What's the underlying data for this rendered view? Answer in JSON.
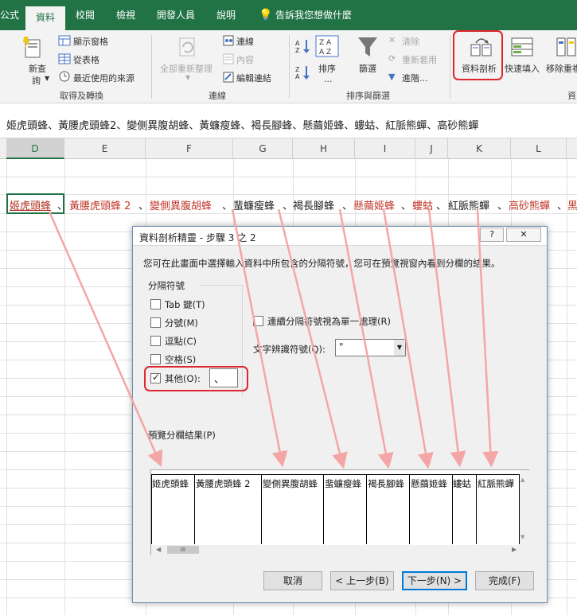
{
  "tabs": [
    {
      "label": "公式"
    },
    {
      "label": "資料",
      "active": true
    },
    {
      "label": "校閱"
    },
    {
      "label": "檢視"
    },
    {
      "label": "開發人員"
    },
    {
      "label": "說明"
    }
  ],
  "tell_me": "告訴我您想做什麼",
  "ribbon": {
    "new_query": [
      "新查",
      "詢"
    ],
    "show_queries": "顯示窗格",
    "from_table": "從表格",
    "recent_sources": "最近使用的來源",
    "get_transform_group": "取得及轉換",
    "refresh_all": "全部重新整理",
    "connections": "連線",
    "properties": "內容",
    "edit_links": "編輯連結",
    "connections_group": "連線",
    "sort": "排序",
    "filter": "篩選",
    "clear": "清除",
    "reapply": "重新套用",
    "advanced": "進階...",
    "sort_filter_group": "排序與篩選",
    "text_to_columns": "資料剖析",
    "flash_fill": "快速填入",
    "remove_dup": "移除重複",
    "data_tools_group": "資"
  },
  "formula_bar": "姬虎頭蜂、黃腰虎頭蜂2、變側異腹胡蜂、黃蠊瘦蜂、褐長腳蜂、懸繭姬蜂、螻蛄、紅脈熊蟬、高砂熊蟬",
  "columns": [
    "D",
    "E",
    "F",
    "G",
    "H",
    "I",
    "J",
    "K",
    "L"
  ],
  "cell_segments": [
    "姬虎頭蜂",
    "黃腰虎頭蜂 2",
    "變側異腹胡蜂",
    "蜚蠊瘦蜂",
    "褐長腳蜂",
    "懸繭姬蜂",
    "螻蛄",
    "紅脈熊蟬",
    "高砂熊蟬",
    "黑"
  ],
  "cell_sep": "、",
  "dialog": {
    "title": "資料剖析精靈 - 步驟 3 之 2",
    "help": "?",
    "close": "✕",
    "instructions": "您可在此畫面中選擇輸入資料中所包含的分隔符號，您可在預覽視窗內看到分欄的結果。",
    "delimiters_label": "分隔符號",
    "options": [
      {
        "label": "Tab 鍵(T)",
        "checked": false
      },
      {
        "label": "分號(M)",
        "checked": false
      },
      {
        "label": "逗點(C)",
        "checked": false
      },
      {
        "label": "空格(S)",
        "checked": false
      },
      {
        "label": "其他(O):",
        "checked": true
      }
    ],
    "other_value": "、",
    "consecutive_label": "連續分隔符號視為單一處理(R)",
    "qualifier_label": "文字辨識符號(Q):",
    "qualifier_value": "\"",
    "preview_label": "預覽分欄結果(P)",
    "preview_columns": [
      "姬虎頭蜂",
      "黃腰虎頭蜂  2",
      "變側異腹胡蜂",
      "蜚蠊瘦蜂",
      "褐長腳蜂",
      "懸繭姬蜂",
      "螻蛄",
      "紅脈熊蟬"
    ],
    "scroll_thumb": "III",
    "buttons": {
      "cancel": "取消",
      "back": "< 上一步(B)",
      "next": "下一步(N) >",
      "finish": "完成(F)"
    }
  },
  "colors": {
    "excel_green": "#217346",
    "highlight": "#e0262f",
    "arrow": "#f4a6a6"
  }
}
